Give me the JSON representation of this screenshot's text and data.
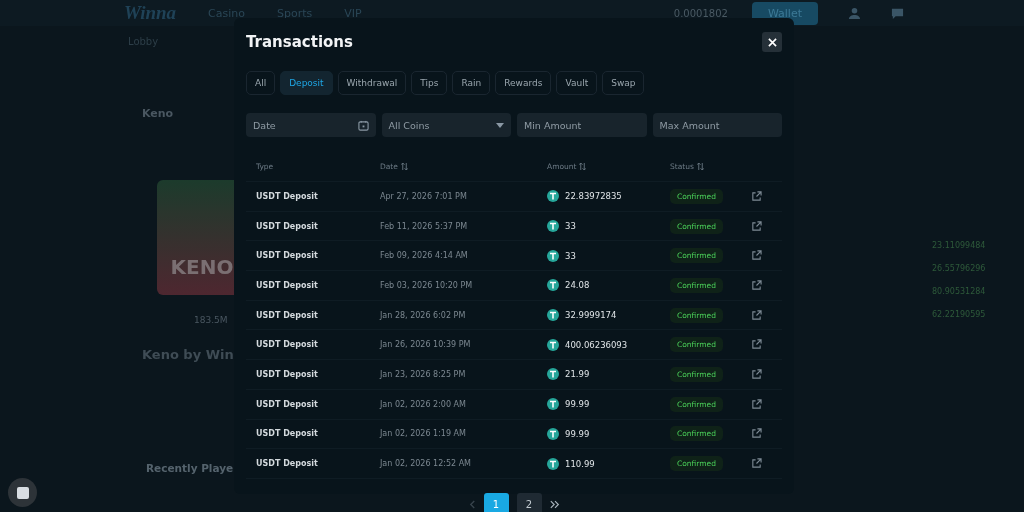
{
  "background": {
    "logo": "Winna",
    "nav": [
      "Casino",
      "Sports",
      "VIP"
    ],
    "balance": "0.0001802",
    "wallet_button": "Wallet",
    "lobby_label": "Lobby",
    "game_title": "Keno",
    "game_card_title": "KENO",
    "total_bet": "183.5M",
    "game_heading": "Keno by Win",
    "recent_heading": "Recently Playe",
    "side_amounts": [
      "23.11099484",
      "26.55796296",
      "80.90531284",
      "62.22190595"
    ]
  },
  "modal": {
    "title": "Transactions",
    "tabs": [
      {
        "label": "All",
        "selected": false
      },
      {
        "label": "Deposit",
        "selected": true
      },
      {
        "label": "Withdrawal",
        "selected": false
      },
      {
        "label": "Tips",
        "selected": false
      },
      {
        "label": "Rain",
        "selected": false
      },
      {
        "label": "Rewards",
        "selected": false
      },
      {
        "label": "Vault",
        "selected": false
      },
      {
        "label": "Swap",
        "selected": false
      }
    ],
    "filters": {
      "date_placeholder": "Date",
      "coin_value": "All Coins",
      "min_placeholder": "Min Amount",
      "max_placeholder": "Max Amount"
    },
    "columns": [
      {
        "label": "Type",
        "sortable": false
      },
      {
        "label": "Date",
        "sortable": true
      },
      {
        "label": "Amount",
        "sortable": true
      },
      {
        "label": "Status",
        "sortable": true
      }
    ],
    "rows": [
      {
        "type": "USDT Deposit",
        "date": "Apr 27, 2026 7:01 PM",
        "amount": "22.83972835",
        "status": "Confirmed"
      },
      {
        "type": "USDT Deposit",
        "date": "Feb 11, 2026 5:37 PM",
        "amount": "33",
        "status": "Confirmed"
      },
      {
        "type": "USDT Deposit",
        "date": "Feb 09, 2026 4:14 AM",
        "amount": "33",
        "status": "Confirmed"
      },
      {
        "type": "USDT Deposit",
        "date": "Feb 03, 2026 10:20 PM",
        "amount": "24.08",
        "status": "Confirmed"
      },
      {
        "type": "USDT Deposit",
        "date": "Jan 28, 2026 6:02 PM",
        "amount": "32.9999174",
        "status": "Confirmed"
      },
      {
        "type": "USDT Deposit",
        "date": "Jan 26, 2026 10:39 PM",
        "amount": "400.06236093",
        "status": "Confirmed"
      },
      {
        "type": "USDT Deposit",
        "date": "Jan 23, 2026 8:25 PM",
        "amount": "21.99",
        "status": "Confirmed"
      },
      {
        "type": "USDT Deposit",
        "date": "Jan 02, 2026 2:00 AM",
        "amount": "99.99",
        "status": "Confirmed"
      },
      {
        "type": "USDT Deposit",
        "date": "Jan 02, 2026 1:19 AM",
        "amount": "99.99",
        "status": "Confirmed"
      },
      {
        "type": "USDT Deposit",
        "date": "Jan 02, 2026 12:52 AM",
        "amount": "110.99",
        "status": "Confirmed"
      }
    ],
    "pagination": {
      "prev_disabled": true,
      "pages": [
        {
          "label": "1",
          "selected": true
        },
        {
          "label": "2",
          "selected": false
        }
      ]
    }
  }
}
